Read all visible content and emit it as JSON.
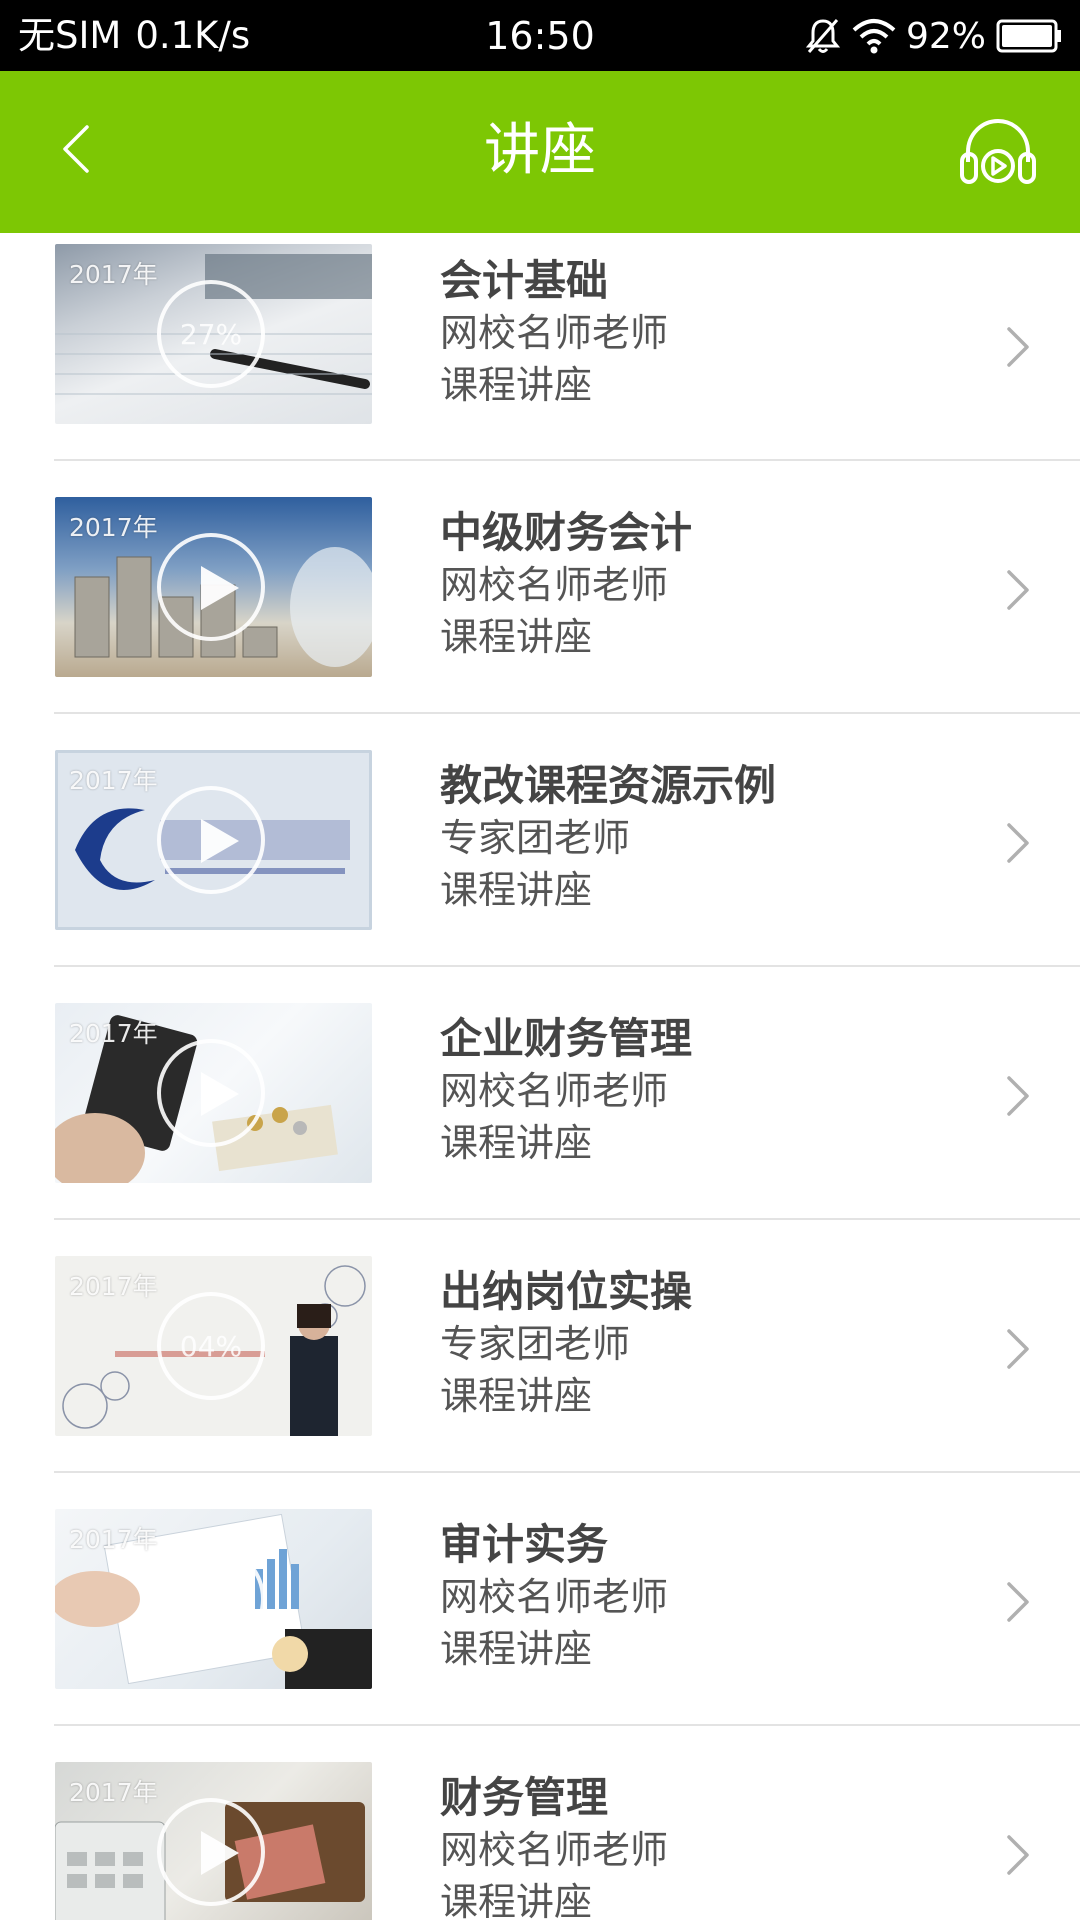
{
  "status_bar": {
    "carrier": "无SIM",
    "speed": "0.1K/s",
    "time": "16:50",
    "battery": "92%",
    "icons": [
      "bell-off-icon",
      "wifi-icon",
      "battery-icon"
    ]
  },
  "header": {
    "title": "讲座",
    "back_icon": "chevron-left-icon",
    "audio_icon": "headphones-play-icon",
    "color": "#7dc704"
  },
  "list": {
    "items": [
      {
        "title": "会计基础",
        "teacher": "网校名师老师",
        "type": "课程讲座",
        "year": "2017年",
        "progress_label": "27%"
      },
      {
        "title": "中级财务会计",
        "teacher": "网校名师老师",
        "type": "课程讲座",
        "year": "2017年"
      },
      {
        "title": "教改课程资源示例",
        "teacher": "专家团老师",
        "type": "课程讲座",
        "year": "2017年"
      },
      {
        "title": "企业财务管理",
        "teacher": "网校名师老师",
        "type": "课程讲座",
        "year": "2017年"
      },
      {
        "title": "出纳岗位实操",
        "teacher": "专家团老师",
        "type": "课程讲座",
        "year": "2017年",
        "progress_label": "04%"
      },
      {
        "title": "审计实务",
        "teacher": "网校名师老师",
        "type": "课程讲座",
        "year": "2017年"
      },
      {
        "title": "财务管理",
        "teacher": "网校名师老师",
        "type": "课程讲座",
        "year": "2017年"
      }
    ]
  }
}
